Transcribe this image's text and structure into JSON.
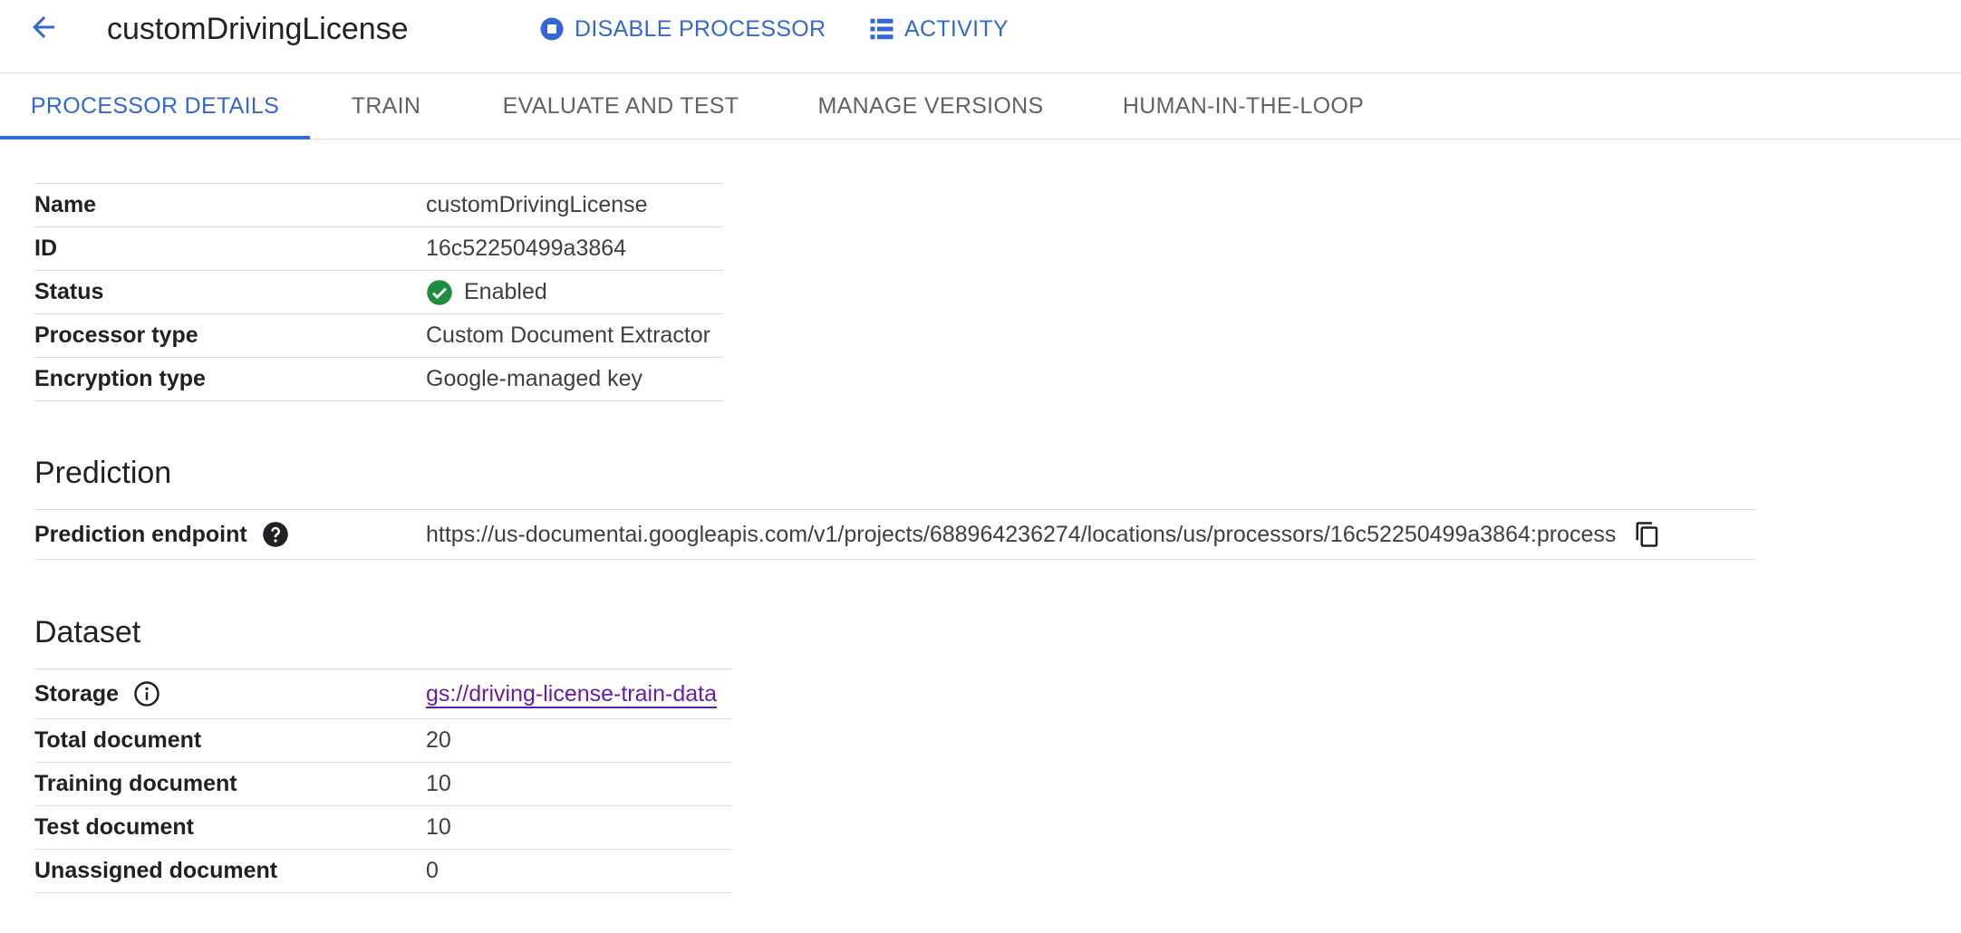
{
  "header": {
    "back_icon": "arrow-back-icon",
    "title": "customDrivingLicense",
    "disable_processor_label": "DISABLE PROCESSOR",
    "activity_label": "ACTIVITY",
    "accent_color": "#3367d6"
  },
  "tabs": [
    {
      "label": "PROCESSOR DETAILS",
      "active": true
    },
    {
      "label": "TRAIN",
      "active": false
    },
    {
      "label": "EVALUATE AND TEST",
      "active": false
    },
    {
      "label": "MANAGE VERSIONS",
      "active": false
    },
    {
      "label": "HUMAN-IN-THE-LOOP",
      "active": false
    }
  ],
  "details": {
    "rows": [
      {
        "key": "Name",
        "value": "customDrivingLicense"
      },
      {
        "key": "ID",
        "value": "16c52250499a3864"
      },
      {
        "key": "Status",
        "value": "Enabled",
        "icon": "check-circle-icon",
        "icon_color": "#1e8e3e"
      },
      {
        "key": "Processor type",
        "value": "Custom Document Extractor"
      },
      {
        "key": "Encryption type",
        "value": "Google-managed key"
      }
    ]
  },
  "prediction": {
    "title": "Prediction",
    "endpoint_label": "Prediction endpoint",
    "endpoint_url": "https://us-documentai.googleapis.com/v1/projects/688964236274/locations/us/processors/16c52250499a3864:process"
  },
  "dataset": {
    "title": "Dataset",
    "storage_label": "Storage",
    "storage_link": "gs://driving-license-train-data",
    "link_color": "#681da8",
    "rows": [
      {
        "key": "Total document",
        "value": "20"
      },
      {
        "key": "Training document",
        "value": "10"
      },
      {
        "key": "Test document",
        "value": "10"
      },
      {
        "key": "Unassigned document",
        "value": "0"
      }
    ]
  }
}
